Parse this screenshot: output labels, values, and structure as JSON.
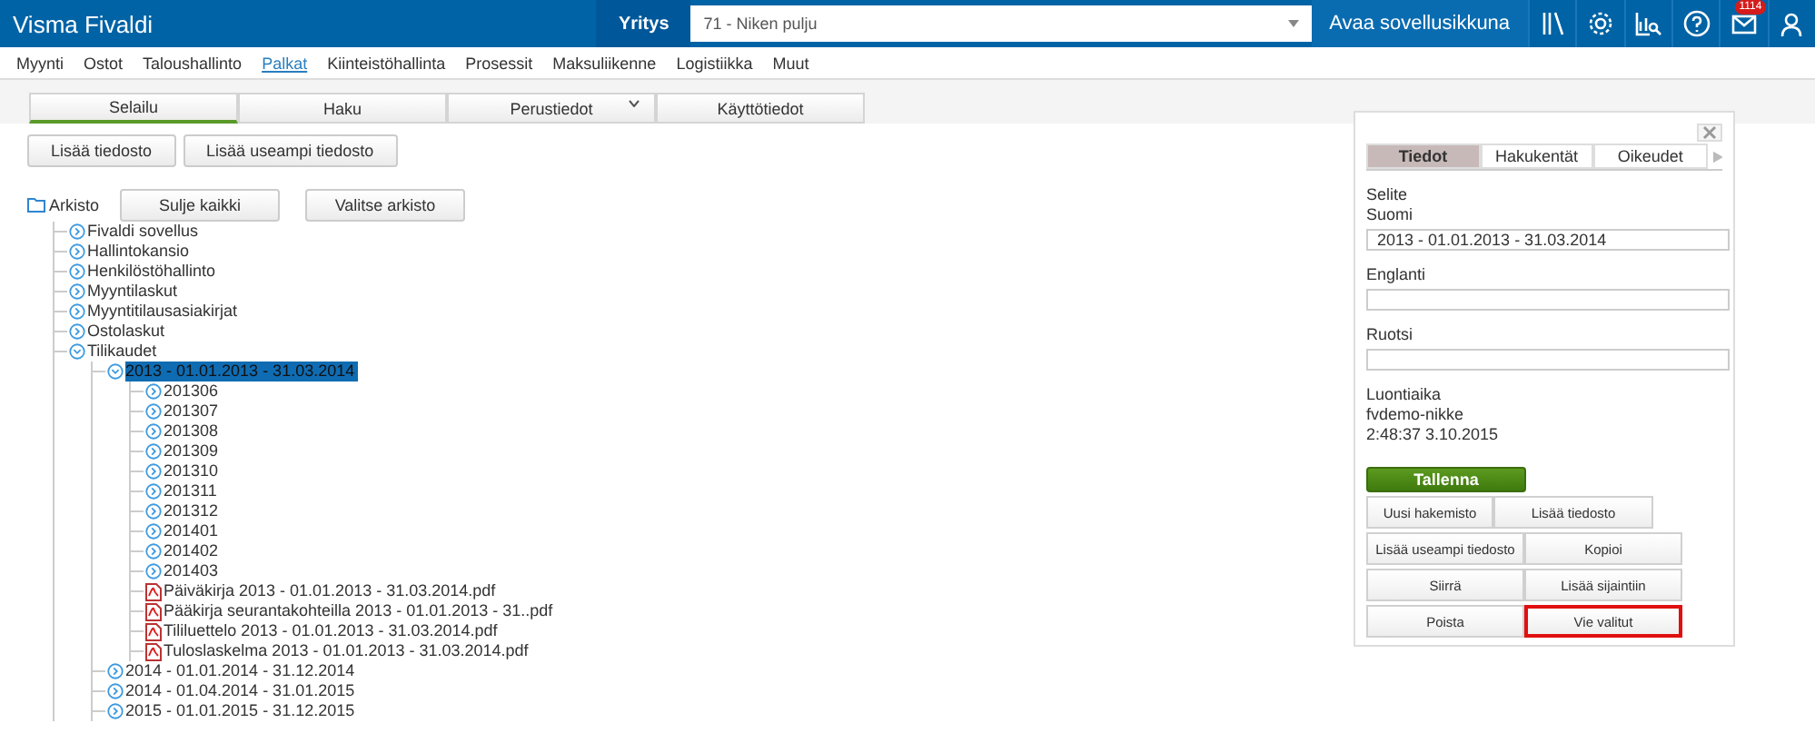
{
  "header": {
    "app_title": "Visma Fivaldi",
    "company_label": "Yritys",
    "company_value": "71 - Niken pulju",
    "open_window": "Avaa sovellusikkuna",
    "mail_badge": "1114"
  },
  "nav": [
    {
      "label": "Myynti",
      "selected": false
    },
    {
      "label": "Ostot",
      "selected": false
    },
    {
      "label": "Taloushallinto",
      "selected": false
    },
    {
      "label": "Palkat",
      "selected": true
    },
    {
      "label": "Kiinteistöhallinta",
      "selected": false
    },
    {
      "label": "Prosessit",
      "selected": false
    },
    {
      "label": "Maksuliikenne",
      "selected": false
    },
    {
      "label": "Logistiikka",
      "selected": false
    },
    {
      "label": "Muut",
      "selected": false
    }
  ],
  "tabs": [
    {
      "label": "Selailu",
      "selected": true,
      "dropdown": false
    },
    {
      "label": "Haku",
      "selected": false,
      "dropdown": false
    },
    {
      "label": "Perustiedot",
      "selected": false,
      "dropdown": true
    },
    {
      "label": "Käyttötiedot",
      "selected": false,
      "dropdown": false
    }
  ],
  "file_buttons": [
    "Lisää tiedosto",
    "Lisää useampi tiedosto"
  ],
  "archive": {
    "label": "Arkisto",
    "buttons": [
      "Sulje kaikki",
      "Valitse arkisto"
    ]
  },
  "tree": [
    {
      "kind": "folder",
      "label": "Fivaldi sovellus",
      "expanded": false,
      "selected": false
    },
    {
      "kind": "folder",
      "label": "Hallintokansio",
      "expanded": false,
      "selected": false
    },
    {
      "kind": "folder",
      "label": "Henkilöstöhallinto",
      "expanded": false,
      "selected": false
    },
    {
      "kind": "folder",
      "label": "Myyntilaskut",
      "expanded": false,
      "selected": false
    },
    {
      "kind": "folder",
      "label": "Myyntitilausasiakirjat",
      "expanded": false,
      "selected": false
    },
    {
      "kind": "folder",
      "label": "Ostolaskut",
      "expanded": false,
      "selected": false
    },
    {
      "kind": "folder",
      "label": "Tilikaudet",
      "expanded": true,
      "selected": false,
      "children": [
        {
          "kind": "folder",
          "label": "2013 - 01.01.2013 - 31.03.2014",
          "expanded": true,
          "selected": true,
          "children": [
            {
              "kind": "folder",
              "label": "201306",
              "expanded": false,
              "selected": false
            },
            {
              "kind": "folder",
              "label": "201307",
              "expanded": false,
              "selected": false
            },
            {
              "kind": "folder",
              "label": "201308",
              "expanded": false,
              "selected": false
            },
            {
              "kind": "folder",
              "label": "201309",
              "expanded": false,
              "selected": false
            },
            {
              "kind": "folder",
              "label": "201310",
              "expanded": false,
              "selected": false
            },
            {
              "kind": "folder",
              "label": "201311",
              "expanded": false,
              "selected": false
            },
            {
              "kind": "folder",
              "label": "201312",
              "expanded": false,
              "selected": false
            },
            {
              "kind": "folder",
              "label": "201401",
              "expanded": false,
              "selected": false
            },
            {
              "kind": "folder",
              "label": "201402",
              "expanded": false,
              "selected": false
            },
            {
              "kind": "folder",
              "label": "201403",
              "expanded": false,
              "selected": false
            },
            {
              "kind": "pdf",
              "label": "Päiväkirja 2013 - 01.01.2013 - 31.03.2014.pdf",
              "selected": false
            },
            {
              "kind": "pdf",
              "label": "Pääkirja seurantakohteilla 2013 - 01.01.2013 - 31..pdf",
              "selected": false
            },
            {
              "kind": "pdf",
              "label": "Tililuettelo 2013 - 01.01.2013 - 31.03.2014.pdf",
              "selected": false
            },
            {
              "kind": "pdf",
              "label": "Tuloslaskelma 2013 - 01.01.2013 - 31.03.2014.pdf",
              "selected": false
            }
          ]
        },
        {
          "kind": "folder",
          "label": "2014 - 01.01.2014 - 31.12.2014",
          "expanded": false,
          "selected": false
        },
        {
          "kind": "folder",
          "label": "2014 - 01.04.2014 - 31.01.2015",
          "expanded": false,
          "selected": false
        },
        {
          "kind": "folder",
          "label": "2015 - 01.01.2015 - 31.12.2015",
          "expanded": false,
          "selected": false
        }
      ]
    }
  ],
  "panel": {
    "tabs": [
      {
        "label": "Tiedot",
        "selected": true
      },
      {
        "label": "Hakukentät",
        "selected": false
      },
      {
        "label": "Oikeudet",
        "selected": false
      }
    ],
    "section_label": "Selite",
    "fields": [
      {
        "label": "Suomi",
        "value": "2013 - 01.01.2013 - 31.03.2014"
      },
      {
        "label": "Englanti"
      },
      {
        "label": "Ruotsi"
      }
    ],
    "created_label": "Luontiaika",
    "created_by": "fvdemo-nikke",
    "created_at": "2:48:37 3.10.2015",
    "save_button": "Tallenna",
    "button_rows": [
      [
        {
          "label": "Uusi hakemisto",
          "highlighted": false
        },
        {
          "label": "Lisää tiedosto",
          "highlighted": false
        }
      ],
      [
        {
          "label": "Lisää useampi tiedosto",
          "highlighted": false
        },
        {
          "label": "Kopioi",
          "highlighted": false
        }
      ],
      [
        {
          "label": "Siirrä",
          "highlighted": false
        },
        {
          "label": "Lisää sijaintiin",
          "highlighted": false
        }
      ],
      [
        {
          "label": "Poista",
          "highlighted": false
        },
        {
          "label": "Vie valitut",
          "highlighted": true
        }
      ]
    ]
  }
}
